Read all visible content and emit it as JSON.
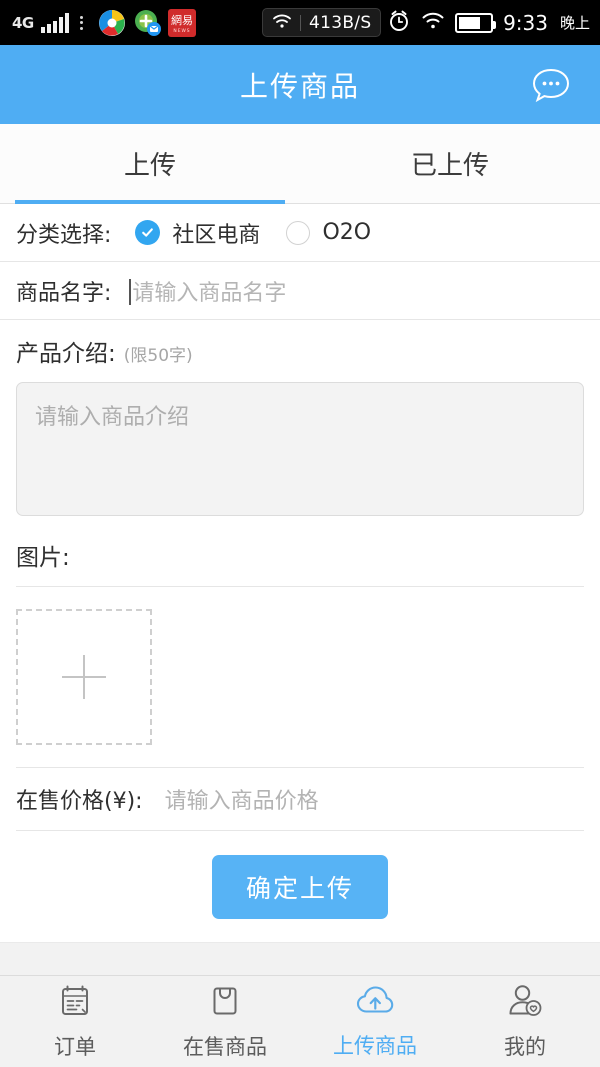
{
  "statusbar": {
    "network_type": "4G",
    "speed_badge": {
      "icon": "wifi-icon",
      "value": "413B/S"
    },
    "alarm_icon": "alarm-clock-icon",
    "wifi_icon": "wifi-icon",
    "battery_icon": "battery-icon",
    "time": "9:33",
    "ampm": "晚上",
    "app_icons": [
      "sina-weibo-icon",
      "uc-browser-icon",
      "netease-news-icon"
    ],
    "netease_label": "網易",
    "netease_sub": "NEWS"
  },
  "header": {
    "title": "上传商品",
    "action_icon": "chat-bubble-icon"
  },
  "tabs": [
    {
      "label": "上传",
      "active": true
    },
    {
      "label": "已上传",
      "active": false
    }
  ],
  "form": {
    "category": {
      "label": "分类选择:",
      "options": [
        {
          "label": "社区电商",
          "selected": true
        },
        {
          "label": "O2O",
          "selected": false
        }
      ]
    },
    "product_name": {
      "label": "商品名字:",
      "value": "",
      "placeholder": "请输入商品名字",
      "focused": true
    },
    "description": {
      "label": "产品介绍:",
      "hint": "(限50字)",
      "value": "",
      "placeholder": "请输入商品介绍"
    },
    "images": {
      "label": "图片:",
      "add_icon": "plus-icon"
    },
    "price": {
      "label": "在售价格(¥):",
      "value": "",
      "placeholder": "请输入商品价格"
    },
    "submit_label": "确定上传"
  },
  "bottomnav": [
    {
      "label": "订单",
      "icon": "order-list-icon",
      "active": false
    },
    {
      "label": "在售商品",
      "icon": "shopping-bag-icon",
      "active": false
    },
    {
      "label": "上传商品",
      "icon": "cloud-upload-icon",
      "active": true
    },
    {
      "label": "我的",
      "icon": "user-heart-icon",
      "active": false
    }
  ],
  "colors": {
    "accent": "#4fadf3",
    "header_bg": "#4fadf3",
    "button_bg": "#57b3f5",
    "statusbar_bg": "#000000",
    "nav_bg": "#f2f2f2",
    "text": "#2f2f2f",
    "placeholder": "#b5b5b5"
  }
}
